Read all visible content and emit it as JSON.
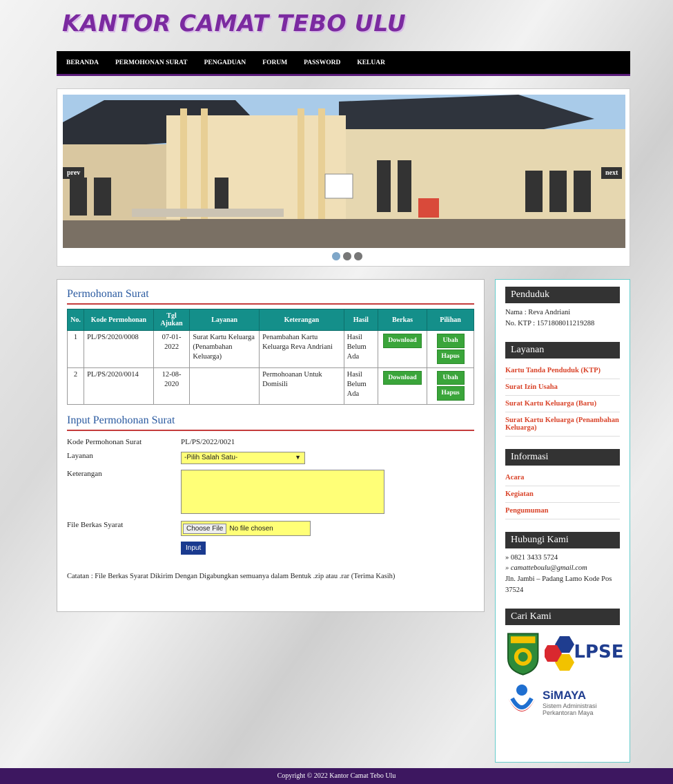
{
  "site": {
    "title": "KANTOR CAMAT TEBO ULU"
  },
  "nav": [
    "BERANDA",
    "PERMOHONAN SURAT",
    "PENGADUAN",
    "FORUM",
    "PASSWORD",
    "KELUAR"
  ],
  "slider": {
    "prev": "prev",
    "next": "next"
  },
  "permohonan": {
    "title": "Permohonan Surat",
    "headers": [
      "No.",
      "Kode Permohonan",
      "Tgl Ajukan",
      "Layanan",
      "Keterangan",
      "Hasil",
      "Berkas",
      "Pilihan"
    ],
    "rows": [
      {
        "no": "1",
        "kode": "PL/PS/2020/0008",
        "tgl": "07-01-2022",
        "layanan": "Surat Kartu Keluarga (Penambahan Keluarga)",
        "ket": "Penambahan Kartu Keluarga Reva Andriani",
        "hasil": "Hasil Belum Ada",
        "download": "Download",
        "ubah": "Ubah",
        "hapus": "Hapus"
      },
      {
        "no": "2",
        "kode": "PL/PS/2020/0014",
        "tgl": "12-08-2020",
        "layanan": "",
        "ket": "Permohoanan Untuk Domisili",
        "hasil": "Hasil Belum Ada",
        "download": "Download",
        "ubah": "Ubah",
        "hapus": "Hapus"
      }
    ]
  },
  "form": {
    "title": "Input Permohonan Surat",
    "kode_label": "Kode Permohonan Surat",
    "kode_value": "PL/PS/2022/0021",
    "layanan_label": "Layanan",
    "layanan_value": "-Pilih Salah Satu-",
    "ket_label": "Keterangan",
    "file_label": "File Berkas Syarat",
    "file_btn": "Choose File",
    "file_status": "No file chosen",
    "submit": "Input",
    "note": "Catatan : File Berkas Syarat Dikirim Dengan Digabungkan semuanya dalam Bentuk .zip atau .rar (Terima Kasih)"
  },
  "sidebar": {
    "penduduk_title": "Penduduk",
    "nama": "Nama : Reva Andriani",
    "ktp": "No. KTP : 1571808011219288",
    "layanan_title": "Layanan",
    "layanan_items": [
      "Kartu Tanda Penduduk (KTP)",
      "Surat Izin Usaha",
      "Surat Kartu Keluarga (Baru)",
      "Surat Kartu Keluarga (Penambahan Keluarga)"
    ],
    "informasi_title": "Informasi",
    "informasi_items": [
      "Acara",
      "Kegiatan",
      "Pengumuman"
    ],
    "hubungi_title": "Hubungi Kami",
    "phone": "» 0821 3433 5724",
    "email": "» camatteboulu@gmail.com",
    "address": "Jln. Jambi – Padang Lamo Kode Pos 37524",
    "cari_title": "Cari Kami",
    "lpse": "LPSE",
    "simaya": "SiMAYA",
    "simaya_sub1": "Sistem Administrasi",
    "simaya_sub2": "Perkantoran Maya"
  },
  "footer": "Copyright © 2022 Kantor Camat Tebo Ulu"
}
